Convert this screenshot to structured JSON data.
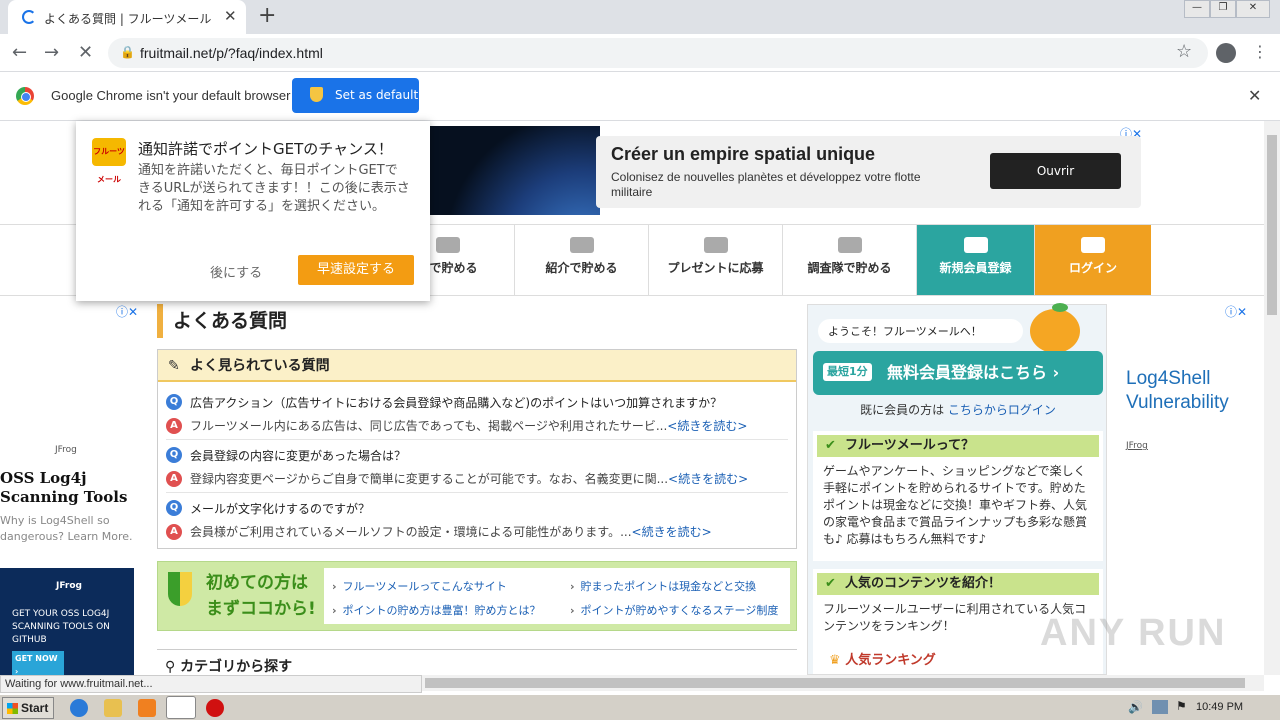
{
  "browser": {
    "tab_title": "よくある質問 | フルーツメール",
    "url": "fruitmail.net/p/?faq/index.html",
    "infobar_text": "Google Chrome isn't your default browser",
    "set_default_label": "Set as default",
    "status": "Waiting for www.fruitmail.net..."
  },
  "banner": {
    "headline": "Créer un empire spatial unique",
    "sub": "Colonisez de nouvelles planètes et développez votre flotte militaire",
    "cta": "Ouvrir"
  },
  "nav": [
    {
      "label": "ムで貯める"
    },
    {
      "label": "紹介で貯める"
    },
    {
      "label": "プレゼントに応募"
    },
    {
      "label": "調査隊で貯める"
    },
    {
      "label": "新規会員登録"
    },
    {
      "label": "ログイン"
    }
  ],
  "notif": {
    "logo": "フルーツメール",
    "title": "通知許諾でポイントGETのチャンス！",
    "body": "通知を許諾いただくと、毎日ポイントGETできるURLが送られてきます！！この後に表示される「通知を許可する」を選択ください。",
    "later": "後にする",
    "go": "早速設定する"
  },
  "left_ad": {
    "brand": "JFrog",
    "title": "OSS Log4j Scanning Tools",
    "sub": "Why is Log4Shell so dangerous? Learn More.",
    "img_text": "GET YOUR OSS LOG4J SCANNING TOOLS ON GITHUB",
    "img_btn": "GET NOW ›",
    "img_brand": "JFrog"
  },
  "main": {
    "title": "よくある質問",
    "faq_header": "よく見られている質問",
    "qa": [
      {
        "q": "広告アクション（広告サイトにおける会員登録や商品購入など)のポイントはいつ加算されますか？",
        "a": "フルーツメール内にある広告は、同じ広告であっても、掲載ページや利用されたサービ...",
        "more": "<続きを読む>"
      },
      {
        "q": "会員登録の内容に変更があった場合は？",
        "a": "登録内容変更ページからご自身で簡単に変更することが可能です。なお、名義変更に関...",
        "more": "<続きを読む>"
      },
      {
        "q": "メールが文字化けするのですが？",
        "a": "会員様がご利用されているメールソフトの設定・環境による可能性があります。...",
        "more": "<続きを読む>"
      }
    ],
    "first_title": "初めての方は まずココから!",
    "first_links": [
      "フルーツメールってこんなサイト",
      "貯まったポイントは現金などと交換",
      "ポイントの貯め方は豊富！貯め方とは？",
      "ポイントが貯めやすくなるステージ制度"
    ],
    "category": "カテゴリから探す"
  },
  "right": {
    "welcome": "ようこそ！フルーツメールへ！",
    "reg_badge": "最短1分",
    "reg_label": "無料会員登録はこちら ›",
    "login_prefix": "既に会員の方は",
    "login_link": "こちらからログイン",
    "about_title": "フルーツメールって？",
    "about_body": "ゲームやアンケート、ショッピングなどで楽しく手軽にポイントを貯められるサイトです。貯めたポイントは現金などに交換！車やギフト券、人気の家電や食品まで賞品ラインナップも多彩な懸賞も♪ 応募はもちろん無料です♪",
    "popular_title": "人気のコンテンツを紹介！",
    "popular_body": "フルーツメールユーザーに利用されている人気コンテンツをランキング！",
    "ranking": "人気ランキング"
  },
  "right_ad": {
    "title": "Log4Shell Vulnerability",
    "brand": "JFrog"
  },
  "watermark": "ANY RUN",
  "taskbar": {
    "start": "Start",
    "time": "10:49 PM"
  }
}
